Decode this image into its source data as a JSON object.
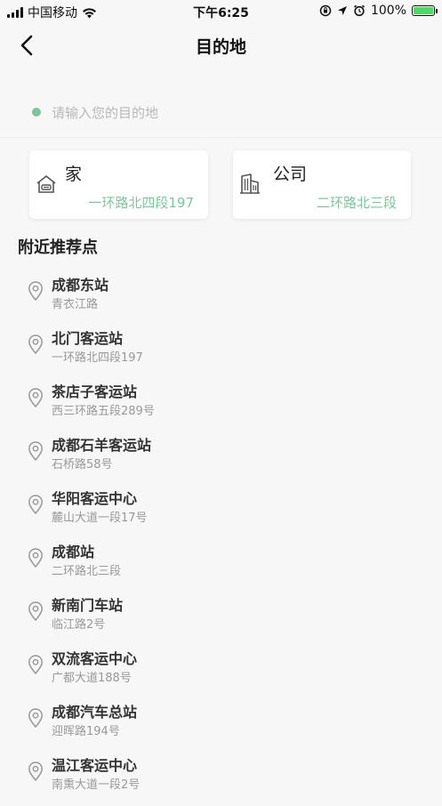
{
  "status_bar": {
    "carrier": "中国移动",
    "time": "下午6:25",
    "battery": "100%"
  },
  "nav": {
    "title": "目的地"
  },
  "search": {
    "placeholder": "请输入您的目的地"
  },
  "shortcuts": {
    "home": {
      "title": "家",
      "address": "一环路北四段197"
    },
    "work": {
      "title": "公司",
      "address": "二环路北三段"
    }
  },
  "nearby": {
    "title": "附近推荐点",
    "items": [
      {
        "name": "成都东站",
        "address": "青衣江路"
      },
      {
        "name": "北门客运站",
        "address": "一环路北四段197"
      },
      {
        "name": "茶店子客运站",
        "address": "西三环路五段289号"
      },
      {
        "name": "成都石羊客运站",
        "address": "石桥路58号"
      },
      {
        "name": "华阳客运中心",
        "address": "麓山大道一段17号"
      },
      {
        "name": "成都站",
        "address": "二环路北三段"
      },
      {
        "name": "新南门车站",
        "address": "临江路2号"
      },
      {
        "name": "双流客运中心",
        "address": "广都大道188号"
      },
      {
        "name": "成都汽车总站",
        "address": "迎晖路194号"
      },
      {
        "name": "温江客运中心",
        "address": "南熏大道一段2号"
      }
    ]
  },
  "colors": {
    "accent": "#7cc79a",
    "background": "#f7f7f7"
  }
}
